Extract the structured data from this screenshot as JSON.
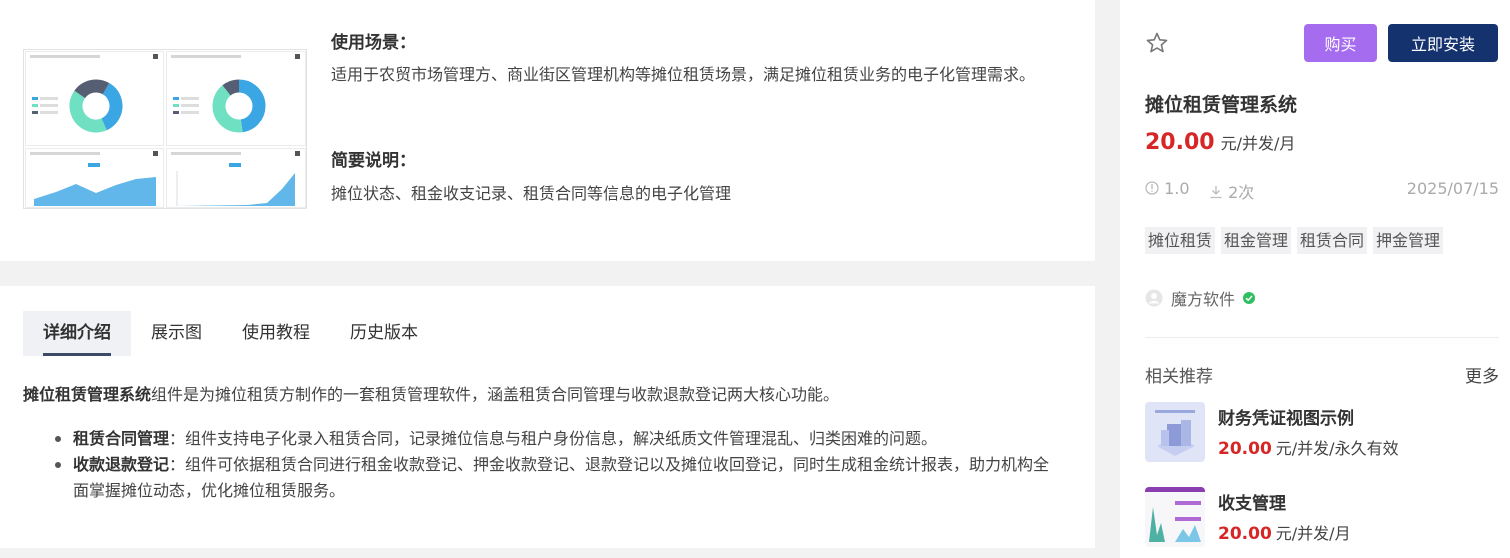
{
  "overview": {
    "usage_title": "使用场景：",
    "usage_text": "适用于农贸市场管理方、商业街区管理机构等摊位租赁场景，满足摊位租赁业务的电子化管理需求。",
    "brief_title": "简要说明：",
    "brief_text": "摊位状态、租金收支记录、租赁合同等信息的电子化管理"
  },
  "tabs": [
    {
      "label": "详细介绍",
      "active": true
    },
    {
      "label": "展示图",
      "active": false
    },
    {
      "label": "使用教程",
      "active": false
    },
    {
      "label": "历史版本",
      "active": false
    }
  ],
  "detail": {
    "intro_bold": "摊位租赁管理系统",
    "intro_rest": "组件是为摊位租赁方制作的一套租赁管理软件，涵盖租赁合同管理与收款退款登记两大核心功能。",
    "bullets": [
      {
        "bold": "租赁合同管理",
        "text": "：组件支持电子化录入租赁合同，记录摊位信息与租户身份信息，解决纸质文件管理混乱、归类困难的问题。"
      },
      {
        "bold": "收款退款登记",
        "text": "：组件可依据租赁合同进行租金收款登记、押金收款登记、退款登记以及摊位收回登记，同时生成租金统计报表，助力机构全面掌握摊位动态，优化摊位租赁服务。"
      }
    ]
  },
  "sidebar": {
    "buy_label": "购买",
    "install_label": "立即安装",
    "product_title": "摊位租赁管理系统",
    "price": "20.00",
    "price_unit": "元/并发/月",
    "version": "1.0",
    "downloads": "2次",
    "date": "2025/07/15",
    "tags": [
      "摊位租赁",
      "租金管理",
      "租赁合同",
      "押金管理"
    ],
    "vendor": "魔方软件",
    "rec_title": "相关推荐",
    "rec_more": "更多",
    "recommendations": [
      {
        "name": "财务凭证视图示例",
        "price": "20.00",
        "unit": "元/并发/永久有效"
      },
      {
        "name": "收支管理",
        "price": "20.00",
        "unit": "元/并发/月"
      }
    ]
  },
  "colors": {
    "buy": "#a56cf0",
    "install": "#13326e",
    "price": "#d62626",
    "verified": "#2fbf62"
  },
  "icons": [
    "star-icon",
    "info-icon",
    "download-icon",
    "user-avatar-icon",
    "verified-icon"
  ]
}
